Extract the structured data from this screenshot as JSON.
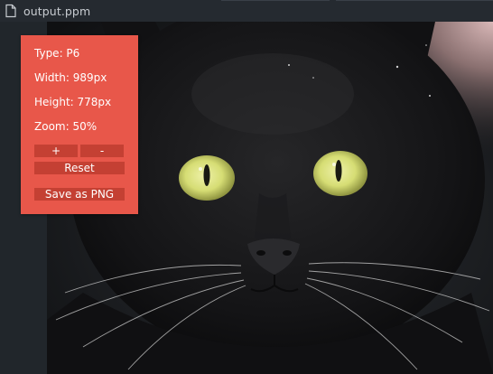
{
  "tab": {
    "icon": "file-icon",
    "title": "output.ppm"
  },
  "image": {
    "subject": "black-cat-photo",
    "eye_color": "#d9e07a"
  },
  "panel": {
    "background": "#e8574a",
    "button_color": "#c44033",
    "type_text": "Type: P6",
    "width_text": "Width: 989px",
    "height_text": "Height: 778px",
    "zoom_text": "Zoom: 50%",
    "zoom_in_label": "+",
    "zoom_out_label": "-",
    "reset_label": "Reset",
    "save_label": "Save as PNG"
  }
}
